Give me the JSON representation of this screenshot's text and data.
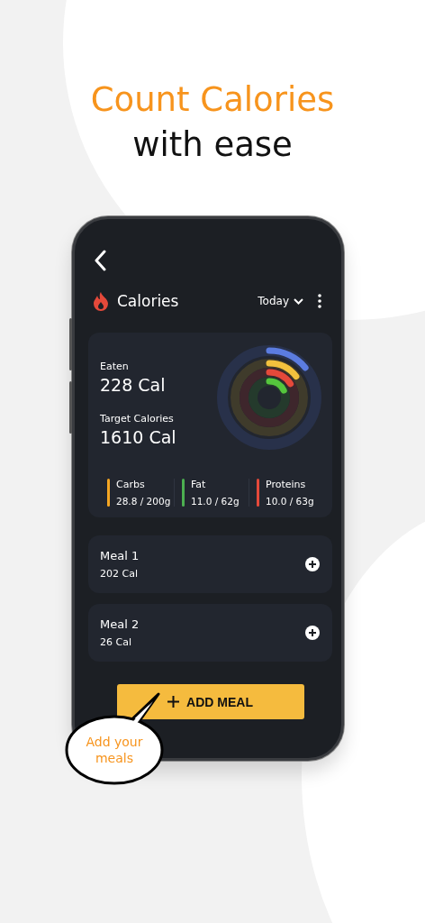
{
  "headline": {
    "accent": "Count Calories",
    "rest": "with ease"
  },
  "screen": {
    "title": "Calories",
    "period": "Today",
    "summary": {
      "eaten_label": "Eaten",
      "eaten": "228 Cal",
      "target_label": "Target Calories",
      "target": "1610 Cal",
      "rings": [
        {
          "level": 0.14
        },
        {
          "level": 0.144
        },
        {
          "level": 0.159
        },
        {
          "level": 0.177
        }
      ]
    },
    "macros": [
      {
        "name": "Carbs",
        "reading": "28.8 / 200g",
        "color": "#f5a623"
      },
      {
        "name": "Fat",
        "reading": "11.0 / 62g",
        "color": "#4caf50"
      },
      {
        "name": "Proteins",
        "reading": "10.0 / 63g",
        "color": "#e5493a"
      }
    ],
    "meals": [
      {
        "name": "Meal 1",
        "calories": "202 Cal"
      },
      {
        "name": "Meal 2",
        "calories": "26 Cal"
      }
    ],
    "add_button": "ADD MEAL"
  },
  "callout": "Add your meals"
}
